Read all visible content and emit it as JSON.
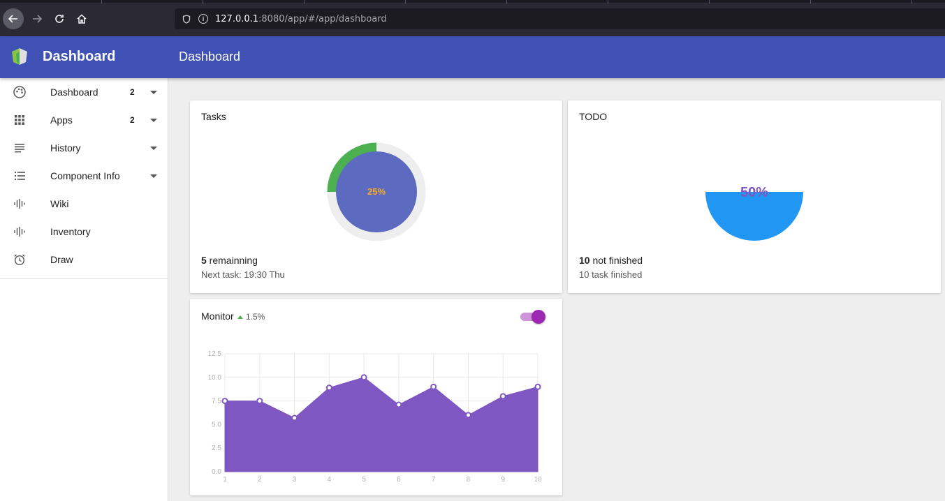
{
  "browser": {
    "url_host": "127.0.0.1",
    "url_rest": ":8080/app/#/app/dashboard"
  },
  "appbar": {
    "brand": "Dashboard",
    "title": "Dashboard",
    "color": "#3f51b5"
  },
  "sidebar": {
    "items": [
      {
        "label": "Dashboard",
        "icon": "palette-icon",
        "badge": "2",
        "expandable": true
      },
      {
        "label": "Apps",
        "icon": "grid-icon",
        "badge": "2",
        "expandable": true
      },
      {
        "label": "History",
        "icon": "lines-icon",
        "badge": "",
        "expandable": true
      },
      {
        "label": "Component Info",
        "icon": "list-icon",
        "badge": "",
        "expandable": true
      },
      {
        "label": "Wiki",
        "icon": "waveform-icon",
        "badge": "",
        "expandable": false
      },
      {
        "label": "Inventory",
        "icon": "waveform-icon",
        "badge": "",
        "expandable": false
      },
      {
        "label": "Draw",
        "icon": "alarm-icon",
        "badge": "",
        "expandable": false
      }
    ]
  },
  "tasks": {
    "title": "Tasks",
    "percent_label": "25%",
    "progress": 0.25,
    "count": "5",
    "count_text": " remainning",
    "sub": "Next task: 19:30 Thu",
    "colors": {
      "progress": "#4caf50",
      "track": "#eeeeee",
      "center": "#5c6bc0",
      "label": "#ffa726"
    }
  },
  "todo": {
    "title": "TODO",
    "percent_label": "50%",
    "progress": 0.5,
    "count": "10",
    "count_text": " not finished",
    "sub": "10 task finished",
    "colors": {
      "fill": "#2196f3",
      "label": "#7e57c2"
    }
  },
  "monitor": {
    "title": "Monitor",
    "delta": "1.5%",
    "toggle_on": true
  },
  "chart_data": {
    "type": "area",
    "x": [
      1,
      2,
      3,
      4,
      5,
      6,
      7,
      8,
      9,
      10
    ],
    "categories": [
      "1",
      "2",
      "3",
      "4",
      "5",
      "6",
      "7",
      "8",
      "9",
      "10"
    ],
    "series": [
      {
        "values": [
          7.5,
          7.5,
          5.7,
          8.9,
          10.0,
          7.1,
          9.0,
          6.0,
          8.0,
          9.0
        ],
        "color": "#7e57c2"
      }
    ],
    "ylim": [
      0,
      12.5
    ],
    "yticks": [
      "0.0",
      "2.5",
      "5.0",
      "7.5",
      "10.0",
      "12.5"
    ],
    "grid": true,
    "title": "",
    "xlabel": "",
    "ylabel": ""
  }
}
